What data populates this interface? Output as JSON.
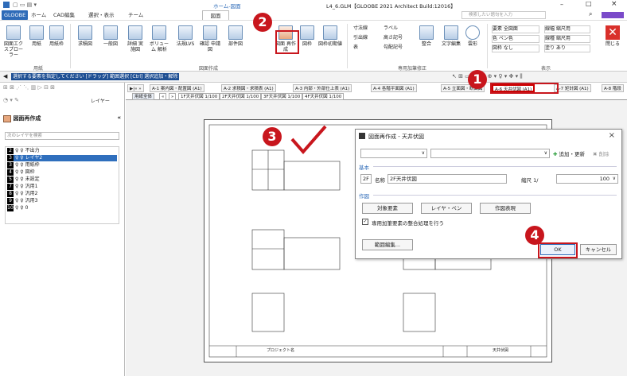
{
  "window": {
    "title": "L4_6.GLM【GLOOBE 2021 Architect Build:12016】",
    "context_tab": "ホーム-図面",
    "minimize": "–",
    "maximize": "□",
    "close": "×"
  },
  "ribbon_tabs": [
    "GLOOBE",
    "ホーム",
    "CAD編集",
    "選択・表示",
    "チーム",
    "図面"
  ],
  "search_help": {
    "placeholder": "検索したい語句を入力"
  },
  "ribbon": {
    "paper_group": {
      "label": "用紙",
      "buttons": [
        "図面エクスプローラー",
        "用紙",
        "用紙枠"
      ]
    },
    "create_group": {
      "label": "図面作成",
      "buttons": [
        "求積図",
        "一般図",
        "詳細 実施図",
        "ボリューム 解析",
        "法規LVS",
        "確認 申請図",
        "部件図",
        "図面 再作成",
        "図枠",
        "図枠初期値"
      ]
    },
    "annot_group": {
      "label": "専用加筆修正",
      "items": [
        "寸法線",
        "ラベル",
        "引出線",
        "高さ記号",
        "表",
        "勾配記号",
        "整合",
        "文字編集",
        "雲形"
      ]
    },
    "display_group": {
      "label": "表示",
      "rows": [
        "要素 全図面",
        "色 ペン色",
        "図枠 なし"
      ],
      "right_rows": [
        "線幅 縮尺用",
        "線種 縮尺用",
        "塗り あり"
      ],
      "close_label": "閉じる"
    }
  },
  "strip": {
    "text": "選択する要素を指定してください [ドラッグ] 範囲選択 [Ctrl] 選択追加・解除"
  },
  "doc_tabs": [
    "A-1 案内図・配置図 (A1)",
    "A-2 求積図・求積表 (A1)",
    "A-3 内部・外部仕上表 (A1)",
    "A-4 各階平面図 (A1)",
    "A-5 立面図・断面図",
    "A-6 天井伏図 (A1)",
    "A-7 矩計図 (A1)",
    "A-8 階段"
  ],
  "sub_tabs": [
    "用紙全体",
    "«",
    "»",
    "1F天井伏図 1/100",
    "2F天井伏図 1/100",
    "3F天井伏図 1/100",
    "4F天井伏図 1/100"
  ],
  "left_panel": {
    "header_menu": "レイヤー",
    "title": "図面再作成",
    "search_placeholder": "次のレイヤを検索",
    "layers": [
      {
        "num": "2",
        "name": "不出力"
      },
      {
        "num": "3",
        "name": "レイヤ2"
      },
      {
        "num": "3",
        "name": "用紙枠"
      },
      {
        "num": "4",
        "name": "図枠"
      },
      {
        "num": "5",
        "name": "未設定"
      },
      {
        "num": "7",
        "name": "汎用1"
      },
      {
        "num": "8",
        "name": "汎用2"
      },
      {
        "num": "9",
        "name": "汎用3"
      },
      {
        "num": "10",
        "name": "0"
      }
    ]
  },
  "dialog": {
    "title": "図面再作成 - 天井伏図",
    "add_update": "追加・更新",
    "delete": "削除",
    "section_basic": "基本",
    "floor": "2F",
    "name_label": "名称",
    "name_value": "2F天井伏図",
    "scale_label": "縮尺 1/",
    "scale_value": "100",
    "section_create": "作図",
    "btn_target": "対象要素",
    "btn_layer": "レイヤ・ペン",
    "btn_expr": "作図表現",
    "checkbox_label": "専用加筆要素の整合処理を行う",
    "btn_range": "範囲編集...",
    "ok": "OK",
    "cancel": "キャンセル"
  },
  "sheet": {
    "project_label": "プロジェクト名",
    "sheet_title": "天井伏図"
  },
  "callouts": [
    "1",
    "2",
    "3",
    "4"
  ],
  "colors": {
    "accent": "#2e6bb8",
    "callout": "#c8161d"
  }
}
